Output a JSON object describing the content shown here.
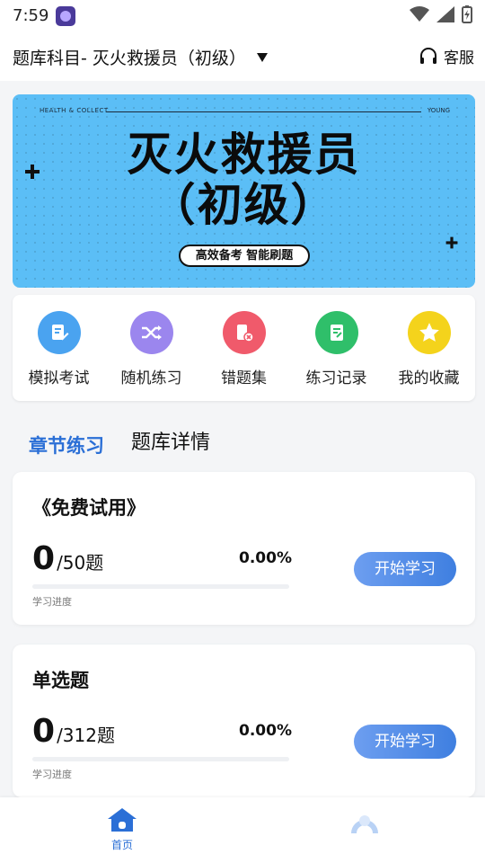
{
  "status_bar": {
    "time": "7:59"
  },
  "header": {
    "subject": "题库科目- 灭火救援员（初级）",
    "service": "客服"
  },
  "banner": {
    "top_left": "HEALTH & COLLECT",
    "top_right": "YOUNG",
    "title": "灭火救援员",
    "subtitle": "（初级）",
    "tag": "高效备考 智能刷题"
  },
  "menu": {
    "items": [
      {
        "label": "模拟考试",
        "color": "#4aa3f0",
        "icon": "exam-edit-icon"
      },
      {
        "label": "随机练习",
        "color": "#9b86ee",
        "icon": "shuffle-icon"
      },
      {
        "label": "错题集",
        "color": "#f05a6b",
        "icon": "wrong-questions-icon"
      },
      {
        "label": "练习记录",
        "color": "#2fbf6a",
        "icon": "record-icon"
      },
      {
        "label": "我的收藏",
        "color": "#f4d31c",
        "icon": "star-icon"
      }
    ]
  },
  "tabs": {
    "active": "章节练习",
    "inactive": "题库详情"
  },
  "courses": [
    {
      "title": "《免费试用》",
      "done": "0",
      "total": "/50题",
      "percent": "0.00%",
      "progress": 0,
      "progress_label": "学习进度",
      "button": "开始学习"
    },
    {
      "title": "单选题",
      "done": "0",
      "total": "/312题",
      "percent": "0.00%",
      "progress": 0,
      "progress_label": "学习进度",
      "button": "开始学习"
    }
  ],
  "bottom_nav": {
    "home_label": "首页",
    "accent": "#2b6fd6"
  }
}
